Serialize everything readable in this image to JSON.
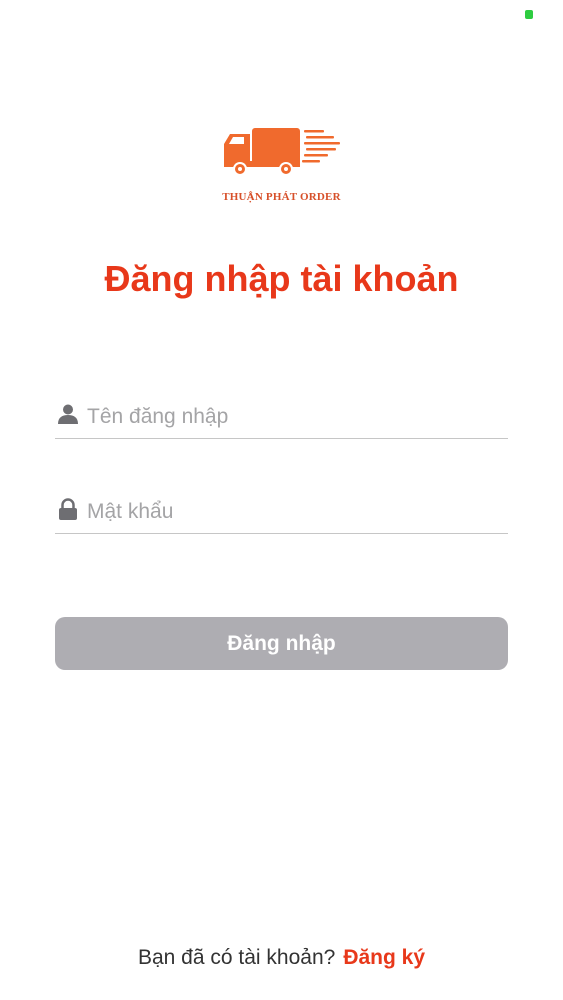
{
  "status_bar": {
    "indicator_color": "#2ecc40"
  },
  "logo": {
    "icon": "delivery-truck-icon",
    "brand_color": "#f06a2d",
    "text": "THUẬN PHÁT ORDER"
  },
  "title": "Đăng nhập tài khoản",
  "form": {
    "username": {
      "icon": "user-icon",
      "placeholder": "Tên đăng nhập",
      "value": ""
    },
    "password": {
      "icon": "lock-icon",
      "placeholder": "Mật khẩu",
      "value": ""
    },
    "login_button_label": "Đăng nhập"
  },
  "footer": {
    "prompt": "Bạn đã có tài khoản?",
    "signup_label": "Đăng ký"
  },
  "colors": {
    "accent": "#e8381a",
    "button_disabled": "#aeadb2",
    "divider": "#c6c6c6",
    "placeholder": "#a4a4a6"
  }
}
